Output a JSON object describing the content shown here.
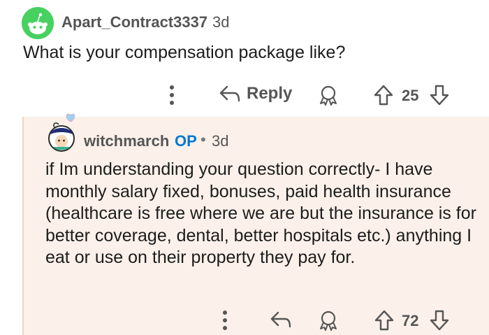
{
  "parent_comment": {
    "author": "Apart_Contract3337",
    "age": "3d",
    "body": "What is your compensation package like?",
    "actions": {
      "reply_label": "Reply",
      "vote_count": "25"
    }
  },
  "reply_comment": {
    "author": "witchmarch",
    "op_badge": "OP",
    "separator": "•",
    "age": "3d",
    "body": "if Im understanding your question correctly- I have monthly salary fixed, bonuses, paid health insurance (healthcare is free where we are but the insurance is for better coverage, dental, better hospitals etc.) anything I eat or use on their property they pay for.",
    "actions": {
      "vote_count": "72"
    }
  },
  "colors": {
    "avatar_green": "#46d160",
    "reply_background": "#fcf1ea",
    "op_blue": "#0079d3",
    "meta_gray": "#555555"
  },
  "icons": {
    "more": "more-vertical-icon",
    "reply": "reply-arrow-icon",
    "award": "award-icon",
    "upvote": "upvote-arrow-icon",
    "downvote": "downvote-arrow-icon"
  }
}
